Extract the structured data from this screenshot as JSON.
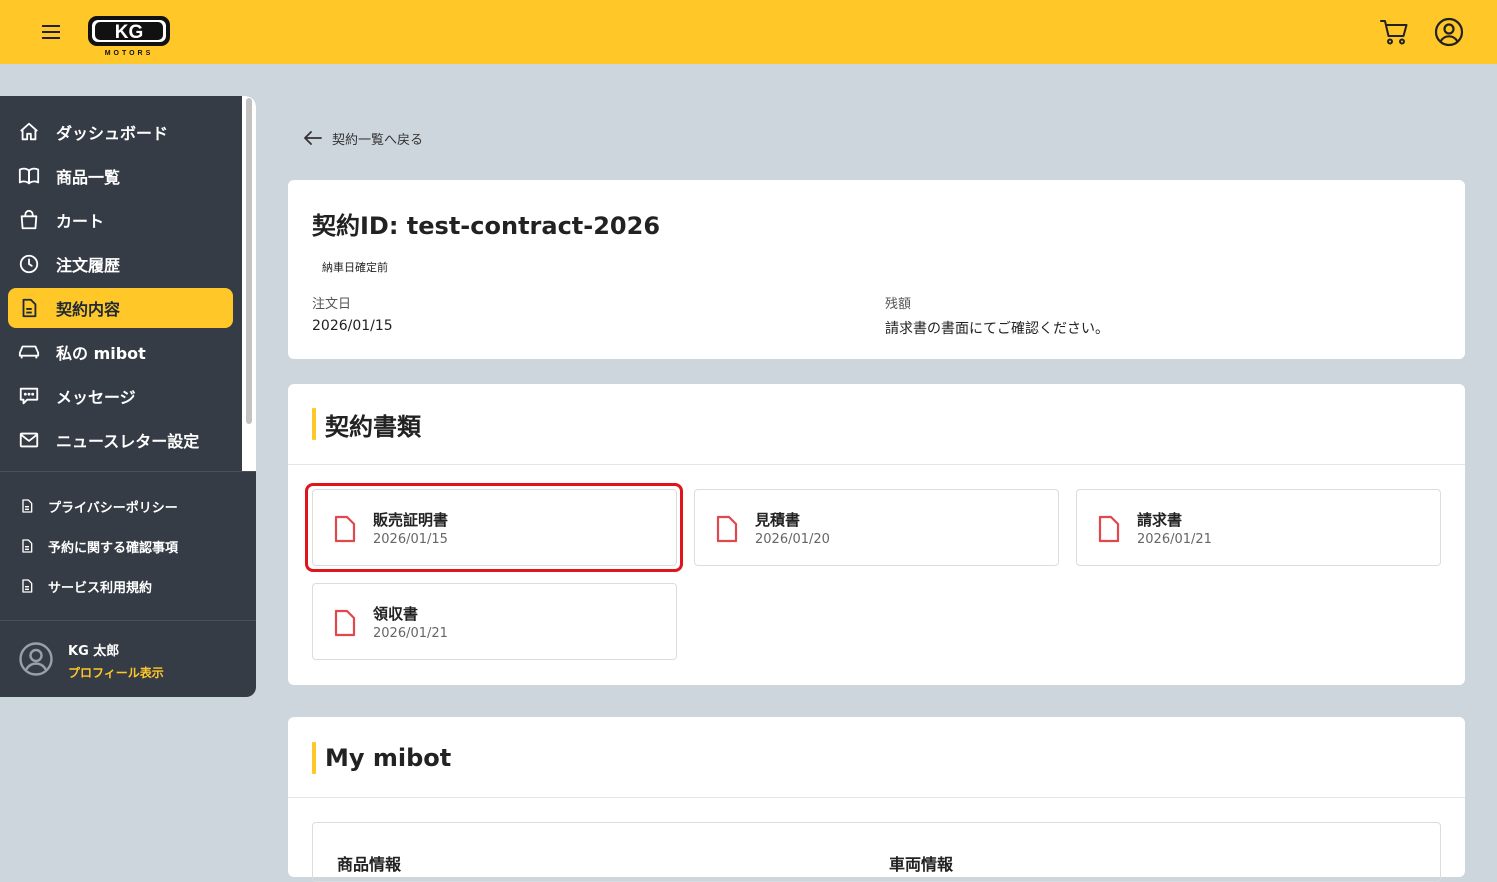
{
  "header": {
    "logo_text": "KG",
    "logo_sub": "MOTORS",
    "colors": {
      "brand_yellow": "#ffc727",
      "sidebar_bg": "#363c46",
      "page_bg": "#cdd6dc",
      "doc_icon_red": "#e0484d",
      "highlight_red": "#e1141b"
    }
  },
  "sidebar": {
    "items": [
      {
        "label": "ダッシュボード",
        "icon": "home-icon"
      },
      {
        "label": "商品一覧",
        "icon": "book-icon"
      },
      {
        "label": "カート",
        "icon": "bag-icon"
      },
      {
        "label": "注文履歴",
        "icon": "clock-icon"
      },
      {
        "label": "契約内容",
        "icon": "document-icon",
        "active": true
      },
      {
        "label": "私の mibot",
        "icon": "car-icon"
      },
      {
        "label": "メッセージ",
        "icon": "chat-icon"
      },
      {
        "label": "ニュースレター設定",
        "icon": "mail-icon"
      }
    ],
    "sub_items": [
      {
        "label": "プライバシーポリシー",
        "icon": "document-icon"
      },
      {
        "label": "予約に関する確認事項",
        "icon": "document-icon"
      },
      {
        "label": "サービス利用規約",
        "icon": "document-icon"
      }
    ],
    "user": {
      "name": "KG 太郎",
      "profile_link": "プロフィール表示"
    }
  },
  "main": {
    "back_link": "契約一覧へ戻る",
    "contract": {
      "title": "契約ID: test-contract-2026",
      "status": "納車日確定前",
      "order_date_label": "注文日",
      "order_date": "2026/01/15",
      "balance_label": "残額",
      "balance_value": "請求書の書面にてご確認ください。"
    },
    "documents": {
      "title": "契約書類",
      "items": [
        {
          "name": "販売証明書",
          "date": "2026/01/15",
          "highlighted": true
        },
        {
          "name": "見積書",
          "date": "2026/01/20"
        },
        {
          "name": "請求書",
          "date": "2026/01/21"
        },
        {
          "name": "領収書",
          "date": "2026/01/21"
        }
      ]
    },
    "my_mibot": {
      "title": "My mibot",
      "left_heading": "商品情報",
      "right_heading": "車両情報"
    }
  }
}
